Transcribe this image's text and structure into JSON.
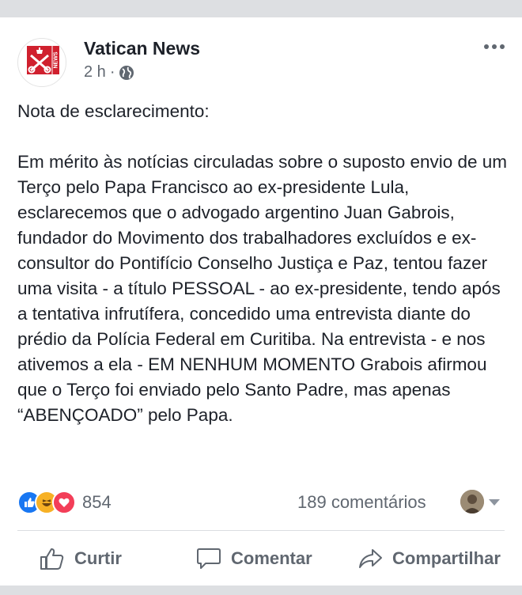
{
  "post": {
    "page_name": "Vatican News",
    "time": "2 h",
    "separator": "·",
    "text": "Nota de esclarecimento:\n\nEm mérito às notícias circuladas sobre o suposto envio de um Terço pelo Papa Francisco ao ex-presidente Lula, esclarecemos que o advogado argentino Juan Gabrois, fundador do Movimento dos trabalhadores excluídos e ex-consultor do Pontifício Conselho Justiça e Paz, tentou fazer uma visita - a título PESSOAL - ao ex-presidente, tendo após a tentativa infrutífera, concedido uma entrevista diante do prédio da Polícia Federal em Curitiba.  Na entrevista - e nos ativemos a ela -  EM NENHUM MOMENTO Grabois afirmou que o Terço foi enviado pelo Santo Padre, mas apenas “ABENÇOADO” pelo Papa."
  },
  "avatar": {
    "logo_text": "NEWS",
    "brand_color": "#d0202e"
  },
  "stats": {
    "reactions": [
      "like",
      "haha",
      "love"
    ],
    "reaction_count": "854",
    "comments": "189 comentários"
  },
  "actions": {
    "like": "Curtir",
    "comment": "Comentar",
    "share": "Compartilhar"
  },
  "colors": {
    "like": "#1877f2",
    "haha": "#f7b125",
    "love": "#f33e58",
    "muted": "#606770"
  }
}
